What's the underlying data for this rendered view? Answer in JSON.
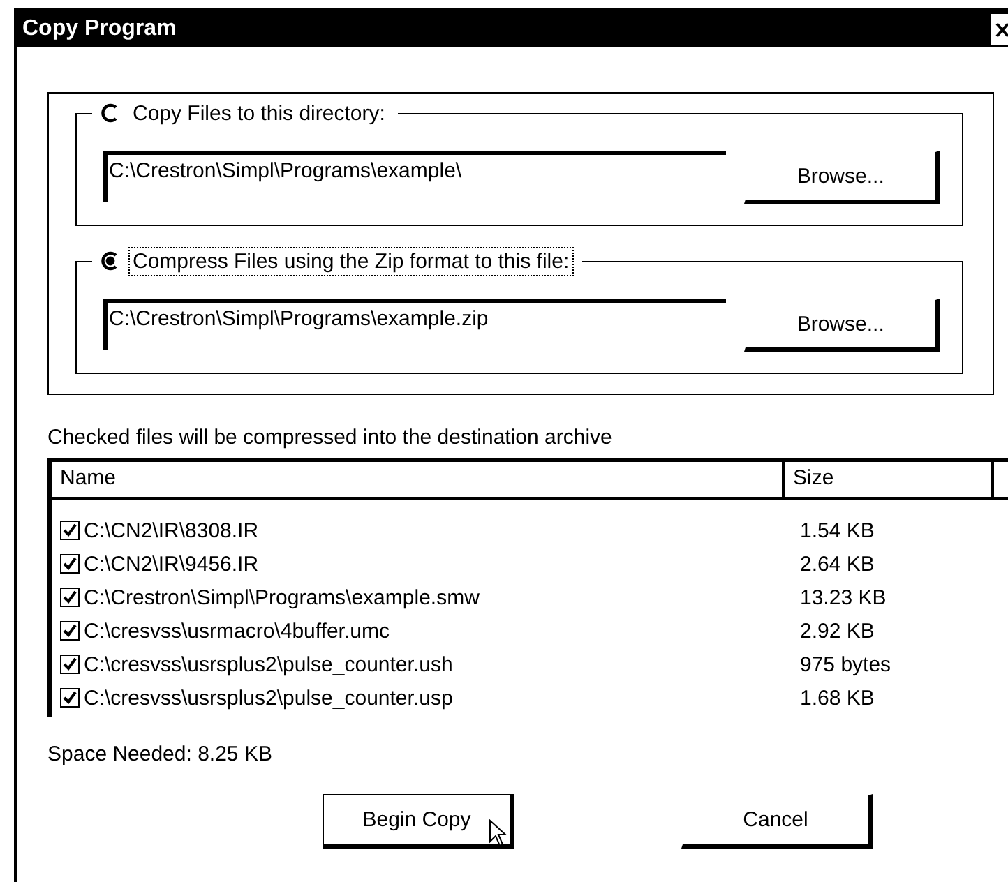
{
  "window": {
    "title": "Copy Program"
  },
  "destinations": [
    {
      "label": "Copy Files to this directory:",
      "selected": false,
      "focused": false,
      "path": "C:\\Crestron\\Simpl\\Programs\\example\\",
      "button": "Browse..."
    },
    {
      "label": "Compress Files using the Zip format to this file:",
      "selected": true,
      "focused": true,
      "path": "C:\\Crestron\\Simpl\\Programs\\example.zip",
      "button": "Browse..."
    }
  ],
  "list_caption": "Checked files will be compressed into the destination archive",
  "file_list": {
    "columns": [
      "Name",
      "Size"
    ],
    "rows": [
      {
        "name": "C:\\CN2\\IR\\8308.IR",
        "size": "1.54 KB",
        "checked": true
      },
      {
        "name": "C:\\CN2\\IR\\9456.IR",
        "size": "2.64 KB",
        "checked": true
      },
      {
        "name": "C:\\Crestron\\Simpl\\Programs\\example.smw",
        "size": "13.23 KB",
        "checked": true
      },
      {
        "name": "C:\\cresvss\\usrmacro\\4buffer.umc",
        "size": "2.92 KB",
        "checked": true
      },
      {
        "name": "C:\\cresvss\\usrsplus2\\pulse_counter.ush",
        "size": "975 bytes",
        "checked": true
      },
      {
        "name": "C:\\cresvss\\usrsplus2\\pulse_counter.usp",
        "size": "1.68 KB",
        "checked": true
      }
    ]
  },
  "space_needed": "Space Needed: 8.25 KB",
  "buttons": [
    {
      "label": "Begin Copy",
      "default": true
    },
    {
      "label": "Cancel",
      "default": false
    }
  ]
}
